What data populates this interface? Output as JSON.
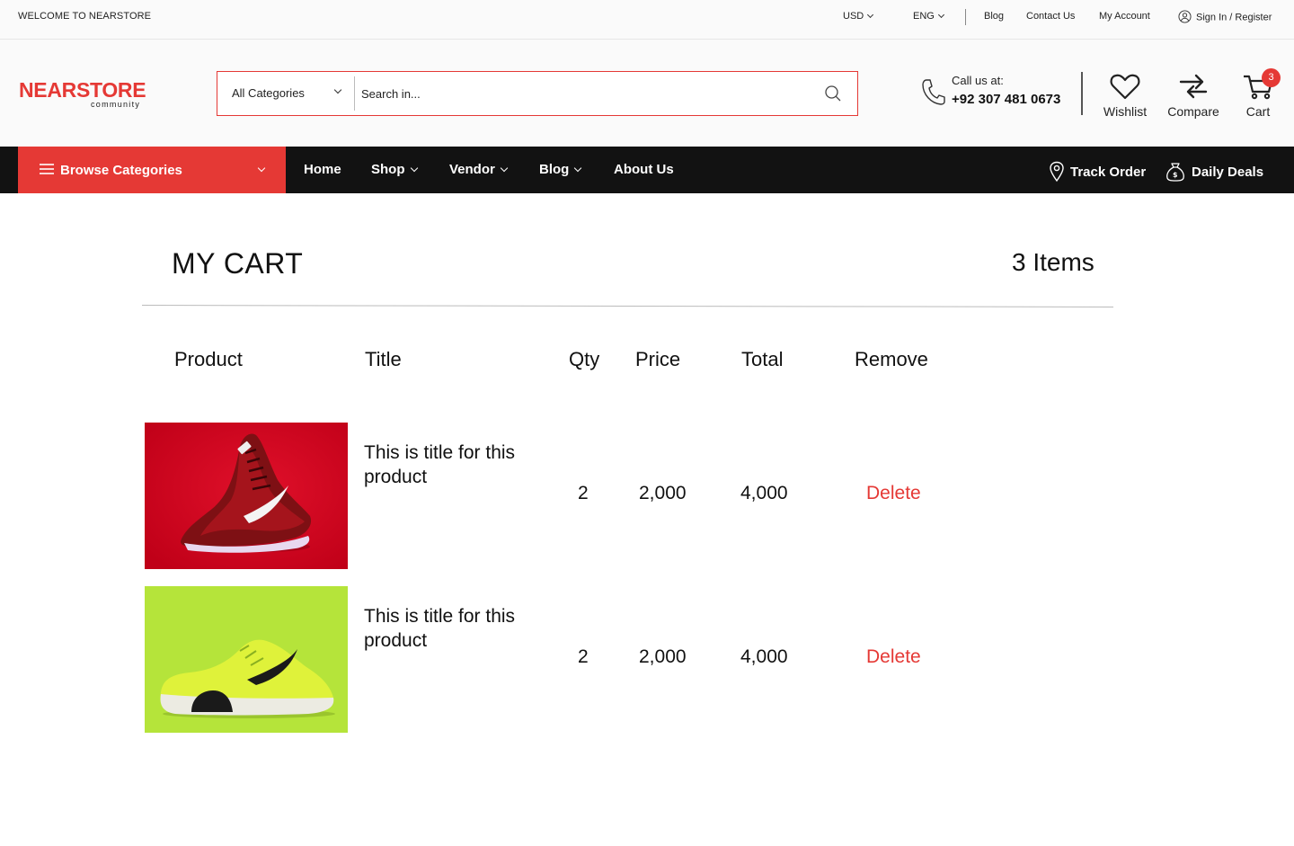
{
  "topbar": {
    "welcome": "WELCOME TO NEARSTORE",
    "currency": "USD",
    "language": "ENG",
    "links": [
      "Blog",
      "Contact Us",
      "My Account"
    ],
    "signin": "Sign In / Register"
  },
  "header": {
    "logo_main": "NEARSTORE",
    "logo_sub": "community",
    "search": {
      "category": "All Categories",
      "placeholder": "Search in..."
    },
    "call": {
      "label": "Call us at:",
      "number": "+92 307 481 0673"
    },
    "wishlist_label": "Wishlist",
    "compare_label": "Compare",
    "cart_label": "Cart",
    "cart_badge": "3"
  },
  "nav": {
    "browse_label": "Browse Categories",
    "links": [
      "Home",
      "Shop",
      "Vendor",
      "Blog",
      "About Us"
    ],
    "track_order": "Track Order",
    "daily_deals": "Daily Deals"
  },
  "cart": {
    "title": "MY CART",
    "count": "3 Items",
    "columns": {
      "product": "Product",
      "title": "Title",
      "qty": "Qty",
      "price": "Price",
      "total": "Total",
      "remove": "Remove"
    },
    "rows": [
      {
        "title": "This is title for this product",
        "qty": "2",
        "price": "2,000",
        "total": "4,000",
        "remove": "Delete",
        "image_color": "#d0021b"
      },
      {
        "title": "This is title for this product",
        "qty": "2",
        "price": "2,000",
        "total": "4,000",
        "remove": "Delete",
        "image_color": "#b5e43a"
      }
    ]
  },
  "colors": {
    "accent": "#e53935",
    "nav_bg": "#121212"
  }
}
